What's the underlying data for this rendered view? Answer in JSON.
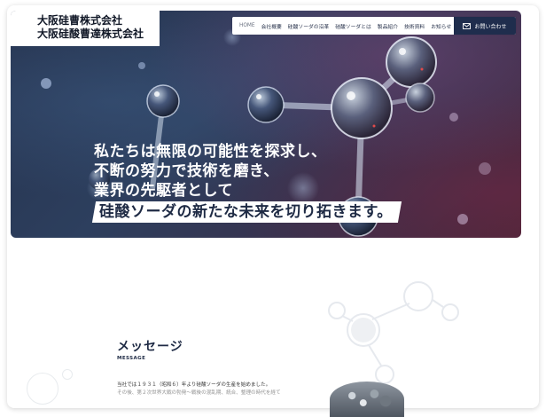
{
  "company": {
    "line1": "大阪硅曹株式会社",
    "line2": "大阪硅酸曹達株式会社"
  },
  "nav": {
    "items": [
      "HOME",
      "会社概要",
      "硅酸ソーダの沿革",
      "硅酸ソーダとは",
      "製品紹介",
      "技術資料",
      "お知らせ"
    ],
    "contact_label": "お問い合わせ"
  },
  "hero": {
    "lines": [
      "私たちは無限の可能性を探求し、",
      "不断の努力で技術を磨き、",
      "業界の先駆者として"
    ],
    "highlight": "硅酸ソーダの新たな未来を切り拓きます。"
  },
  "message": {
    "title": "メッセージ",
    "subtitle": "MESSAGE",
    "body_line1": "当社では１９３１（昭和６）年より硅酸ソーダの生産を始めました。",
    "body_line2": "その後、第２次世界大戦の勃発～戦後の混乱期、統合、整理の時代を経て"
  },
  "colors": {
    "navy": "#1f2d4d",
    "hero_text": "#ffffff",
    "highlight_text": "#1e2a44"
  }
}
